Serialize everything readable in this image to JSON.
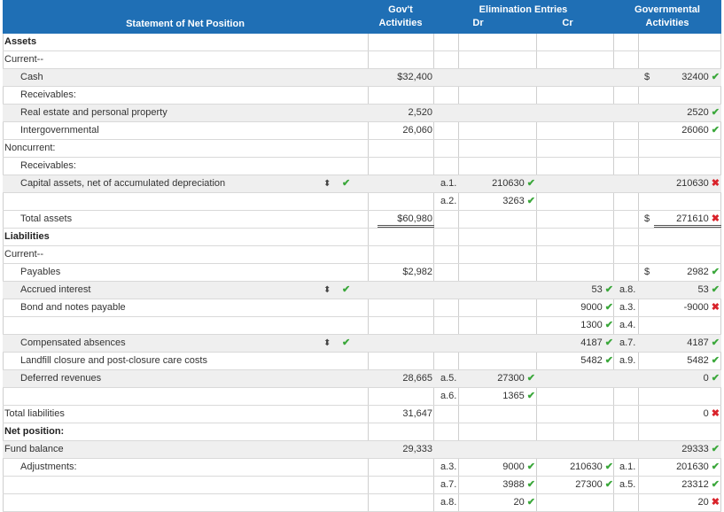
{
  "header": {
    "statement": "Statement of Net Position",
    "gov_line1": "Gov't",
    "gov_line2": "Activities",
    "elim_line1": "Elimination Entries",
    "dr": "Dr",
    "cr": "Cr",
    "ga_line1": "Governmental",
    "ga_line2": "Activities"
  },
  "rows": [
    {
      "label": "Assets",
      "style": "bold"
    },
    {
      "label": "Current--"
    },
    {
      "label": "Cash",
      "ind": 1,
      "gov": "$32,400",
      "dollar": "$",
      "ga": "32400",
      "ga_mark": "ok",
      "shade": 1
    },
    {
      "label": "Receivables:",
      "ind": 1
    },
    {
      "label": "Real estate and personal property",
      "ind": 1,
      "gov": "2,520",
      "ga": "2520",
      "ga_mark": "ok",
      "shade": 1
    },
    {
      "label": "Intergovernmental",
      "ind": 1,
      "gov": "26,060",
      "ga": "26060",
      "ga_mark": "ok"
    },
    {
      "label": "Noncurrent:"
    },
    {
      "label": "Receivables:",
      "ind": 1
    },
    {
      "label": "Capital assets, net of accumulated depreciation",
      "ind": 1,
      "select": 1,
      "refdr": "a.1.",
      "dr": "210630",
      "dr_mark": "ok",
      "ga": "210630",
      "ga_mark": "bad",
      "shade": 1
    },
    {
      "refdr": "a.2.",
      "dr": "3263",
      "dr_mark": "ok"
    },
    {
      "label": "Total assets",
      "ind": 1,
      "gov": "$60,980",
      "gov_ul": "double",
      "dollar": "$",
      "ga": "271610",
      "ga_mark": "bad",
      "ga_ul": "double"
    },
    {
      "label": "Liabilities",
      "style": "bold"
    },
    {
      "label": "Current--"
    },
    {
      "label": "Payables",
      "ind": 1,
      "gov": "$2,982",
      "dollar": "$",
      "ga": "2982",
      "ga_mark": "ok"
    },
    {
      "label": "Accrued interest",
      "ind": 1,
      "select": 1,
      "cr": "53",
      "cr_mark": "ok",
      "refcr": "a.8.",
      "ga": "53",
      "ga_mark": "ok",
      "shade": 1
    },
    {
      "label": "Bond and notes payable",
      "ind": 1,
      "cr": "9000",
      "cr_mark": "ok",
      "refcr": "a.3.",
      "ga": "-9000",
      "ga_mark": "bad"
    },
    {
      "cr": "1300",
      "cr_mark": "ok",
      "refcr": "a.4."
    },
    {
      "label": "Compensated absences",
      "ind": 1,
      "select": 1,
      "cr": "4187",
      "cr_mark": "ok",
      "refcr": "a.7.",
      "ga": "4187",
      "ga_mark": "ok",
      "shade": 1
    },
    {
      "label": "Landfill closure and post-closure care costs",
      "ind": 1,
      "cr": "5482",
      "cr_mark": "ok",
      "refcr": "a.9.",
      "ga": "5482",
      "ga_mark": "ok"
    },
    {
      "label": "Deferred revenues",
      "ind": 1,
      "gov": "28,665",
      "refdr": "a.5.",
      "dr": "27300",
      "dr_mark": "ok",
      "ga": "0",
      "ga_mark": "ok",
      "shade": 1
    },
    {
      "refdr": "a.6.",
      "dr": "1365",
      "dr_mark": "ok"
    },
    {
      "label": "Total liabilities",
      "gov": "31,647",
      "ga": "0",
      "ga_mark": "bad"
    },
    {
      "label": "Net position:",
      "style": "bold"
    },
    {
      "label": "Fund balance",
      "gov": "29,333",
      "ga": "29333",
      "ga_mark": "ok",
      "shade": 1
    },
    {
      "label": "Adjustments:",
      "ind": 1,
      "refdr": "a.3.",
      "dr": "9000",
      "dr_mark": "ok",
      "cr": "210630",
      "cr_mark": "ok",
      "refcr": "a.1.",
      "ga": "201630",
      "ga_mark": "ok"
    },
    {
      "refdr": "a.7.",
      "dr": "3988",
      "dr_mark": "ok",
      "cr": "27300",
      "cr_mark": "ok",
      "refcr": "a.5.",
      "ga": "23312",
      "ga_mark": "ok"
    },
    {
      "refdr": "a.8.",
      "dr": "20",
      "dr_mark": "ok",
      "ga": "20",
      "ga_mark": "bad"
    }
  ],
  "icons": {
    "ok": "✔",
    "bad": "✖",
    "select": "⬍"
  },
  "colors": {
    "header": "#1f6fb5",
    "correct": "#3aa73a",
    "incorrect": "#d9232b",
    "shade": "#efefef"
  }
}
